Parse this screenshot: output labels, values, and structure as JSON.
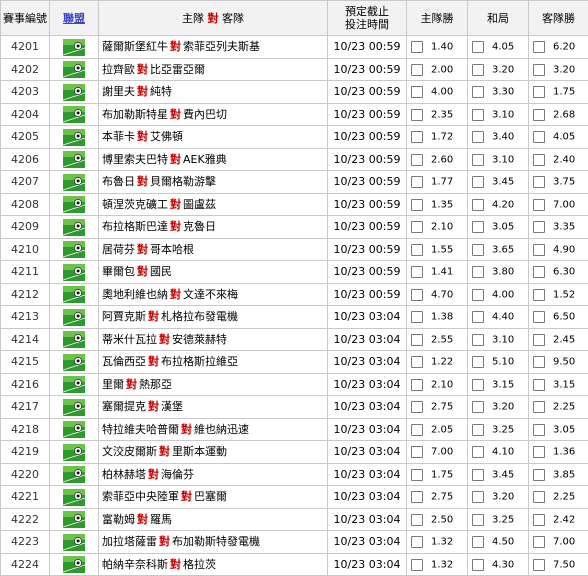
{
  "headers": {
    "id": "賽事編號",
    "league": "聯盟",
    "match_pre": "主隊",
    "match_vs": "對",
    "match_post": "客隊",
    "time_line1": "預定截止",
    "time_line2": "投注時間",
    "home": "主隊勝",
    "draw": "和局",
    "away": "客隊勝"
  },
  "vs_label": "對",
  "rows": [
    {
      "id": "4201",
      "home": "薩爾斯堡紅牛",
      "away": "索菲亞列夫斯基",
      "time": "10/23 00:59",
      "home_odds": "1.40",
      "draw_odds": "4.05",
      "away_odds": "6.20"
    },
    {
      "id": "4202",
      "home": "拉齊歐",
      "away": "比亞雷亞爾",
      "time": "10/23 00:59",
      "home_odds": "2.00",
      "draw_odds": "3.20",
      "away_odds": "3.20"
    },
    {
      "id": "4203",
      "home": "謝里夫",
      "away": "純特",
      "time": "10/23 00:59",
      "home_odds": "4.00",
      "draw_odds": "3.30",
      "away_odds": "1.75"
    },
    {
      "id": "4204",
      "home": "布加勒斯特星",
      "away": "費內巴切",
      "time": "10/23 00:59",
      "home_odds": "2.35",
      "draw_odds": "3.10",
      "away_odds": "2.68"
    },
    {
      "id": "4205",
      "home": "本菲卡",
      "away": "艾佛頓",
      "time": "10/23 00:59",
      "home_odds": "1.72",
      "draw_odds": "3.40",
      "away_odds": "4.05"
    },
    {
      "id": "4206",
      "home": "博里索夫巴特",
      "away": "AEK雅典",
      "time": "10/23 00:59",
      "home_odds": "2.60",
      "draw_odds": "3.10",
      "away_odds": "2.40"
    },
    {
      "id": "4207",
      "home": "布魯日",
      "away": "貝爾格勒游擊",
      "time": "10/23 00:59",
      "home_odds": "1.77",
      "draw_odds": "3.45",
      "away_odds": "3.75"
    },
    {
      "id": "4208",
      "home": "頓涅茨克礦工",
      "away": "圖盧茲",
      "time": "10/23 00:59",
      "home_odds": "1.35",
      "draw_odds": "4.20",
      "away_odds": "7.00"
    },
    {
      "id": "4209",
      "home": "布拉格斯巴達",
      "away": "克魯日",
      "time": "10/23 00:59",
      "home_odds": "2.10",
      "draw_odds": "3.05",
      "away_odds": "3.35"
    },
    {
      "id": "4210",
      "home": "居荷芬",
      "away": "哥本哈根",
      "time": "10/23 00:59",
      "home_odds": "1.55",
      "draw_odds": "3.65",
      "away_odds": "4.90"
    },
    {
      "id": "4211",
      "home": "畢爾包",
      "away": "國民",
      "time": "10/23 00:59",
      "home_odds": "1.41",
      "draw_odds": "3.80",
      "away_odds": "6.30"
    },
    {
      "id": "4212",
      "home": "奧地利維也納",
      "away": "文達不來梅",
      "time": "10/23 00:59",
      "home_odds": "4.70",
      "draw_odds": "4.00",
      "away_odds": "1.52"
    },
    {
      "id": "4213",
      "home": "阿賈克斯",
      "away": "札格拉布發電機",
      "time": "10/23 03:04",
      "home_odds": "1.38",
      "draw_odds": "4.40",
      "away_odds": "6.50"
    },
    {
      "id": "4214",
      "home": "蒂米什瓦拉",
      "away": "安德萊赫特",
      "time": "10/23 03:04",
      "home_odds": "2.55",
      "draw_odds": "3.10",
      "away_odds": "2.45"
    },
    {
      "id": "4215",
      "home": "瓦倫西亞",
      "away": "布拉格斯拉維亞",
      "time": "10/23 03:04",
      "home_odds": "1.22",
      "draw_odds": "5.10",
      "away_odds": "9.50"
    },
    {
      "id": "4216",
      "home": "里爾",
      "away": "熱那亞",
      "time": "10/23 03:04",
      "home_odds": "2.10",
      "draw_odds": "3.15",
      "away_odds": "3.15"
    },
    {
      "id": "4217",
      "home": "塞爾提克",
      "away": "漢堡",
      "time": "10/23 03:04",
      "home_odds": "2.75",
      "draw_odds": "3.20",
      "away_odds": "2.25"
    },
    {
      "id": "4218",
      "home": "特拉維夫哈普爾",
      "away": "維也納迅速",
      "time": "10/23 03:04",
      "home_odds": "2.05",
      "draw_odds": "3.25",
      "away_odds": "3.05"
    },
    {
      "id": "4219",
      "home": "文洨皮爾斯",
      "away": "里斯本運動",
      "time": "10/23 03:04",
      "home_odds": "7.00",
      "draw_odds": "4.10",
      "away_odds": "1.36"
    },
    {
      "id": "4220",
      "home": "柏林赫塔",
      "away": "海倫芬",
      "time": "10/23 03:04",
      "home_odds": "1.75",
      "draw_odds": "3.45",
      "away_odds": "3.85"
    },
    {
      "id": "4221",
      "home": "索菲亞中央陸軍",
      "away": "巴塞爾",
      "time": "10/23 03:04",
      "home_odds": "2.75",
      "draw_odds": "3.20",
      "away_odds": "2.25"
    },
    {
      "id": "4222",
      "home": "富勒姆",
      "away": "羅馬",
      "time": "10/23 03:04",
      "home_odds": "2.50",
      "draw_odds": "3.25",
      "away_odds": "2.42"
    },
    {
      "id": "4223",
      "home": "加拉塔薩雷",
      "away": "布加勒斯特發電機",
      "time": "10/23 03:04",
      "home_odds": "1.32",
      "draw_odds": "4.50",
      "away_odds": "7.00"
    },
    {
      "id": "4224",
      "home": "帕納辛奈科斯",
      "away": "格拉茨",
      "time": "10/23 03:04",
      "home_odds": "1.32",
      "draw_odds": "4.30",
      "away_odds": "7.50"
    }
  ]
}
